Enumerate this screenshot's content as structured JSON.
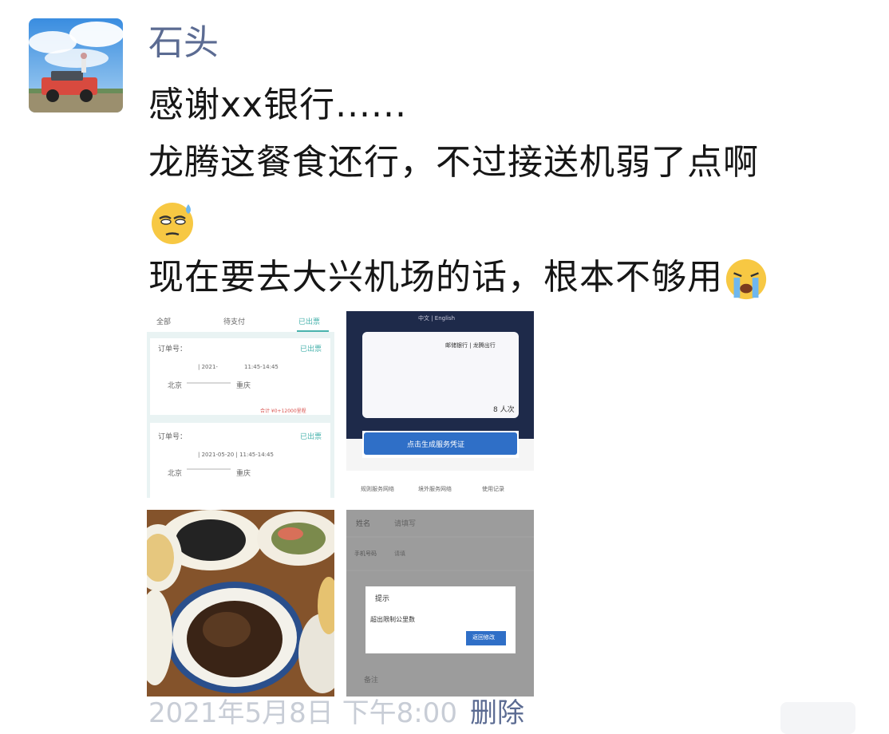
{
  "post": {
    "author": "石头",
    "lines": [
      "感谢xx银行......",
      "龙腾这餐食还行，不过接送机弱了点啊"
    ],
    "line3": "现在要去大兴机场的话，根本不够用",
    "emoji_names": [
      "sweat-smile-icon",
      "crying-face-icon"
    ],
    "timestamp": "2021年5月8日 下午8:00",
    "delete_label": "删除"
  },
  "photo1": {
    "tabs": [
      "全部",
      "待支付",
      "已出票"
    ],
    "order1": {
      "label": "订单号：",
      "status": "已出票",
      "date": "| 2021-",
      "time": "11:45-14:45",
      "from": "北京",
      "to": "重庆",
      "total": "合计 ¥0+12000里程"
    },
    "order2": {
      "label": "订单号：",
      "status": "已出票",
      "date": "| 2021-05-20 | 11:45-14:45",
      "from": "北京",
      "to": "重庆"
    }
  },
  "photo2": {
    "lang": "中文 | English",
    "card_brand": "邮储银行 | 龙腾出行",
    "count": "8 人次",
    "button": "点击生成服务凭证",
    "links": [
      "规则服务网络",
      "境外服务网络",
      "使用记录"
    ]
  },
  "photo4": {
    "field1_label": "姓名",
    "field1_value": "请填写",
    "field2_label": "手机号码",
    "field2_value": "请填",
    "dialog_title": "提示",
    "dialog_msg": "超出限制公里数",
    "dialog_button": "返回修改",
    "bottom_label": "备注"
  },
  "colors": {
    "name": "#5b6b92",
    "text": "#161616",
    "accent": "#2f6fc7"
  }
}
